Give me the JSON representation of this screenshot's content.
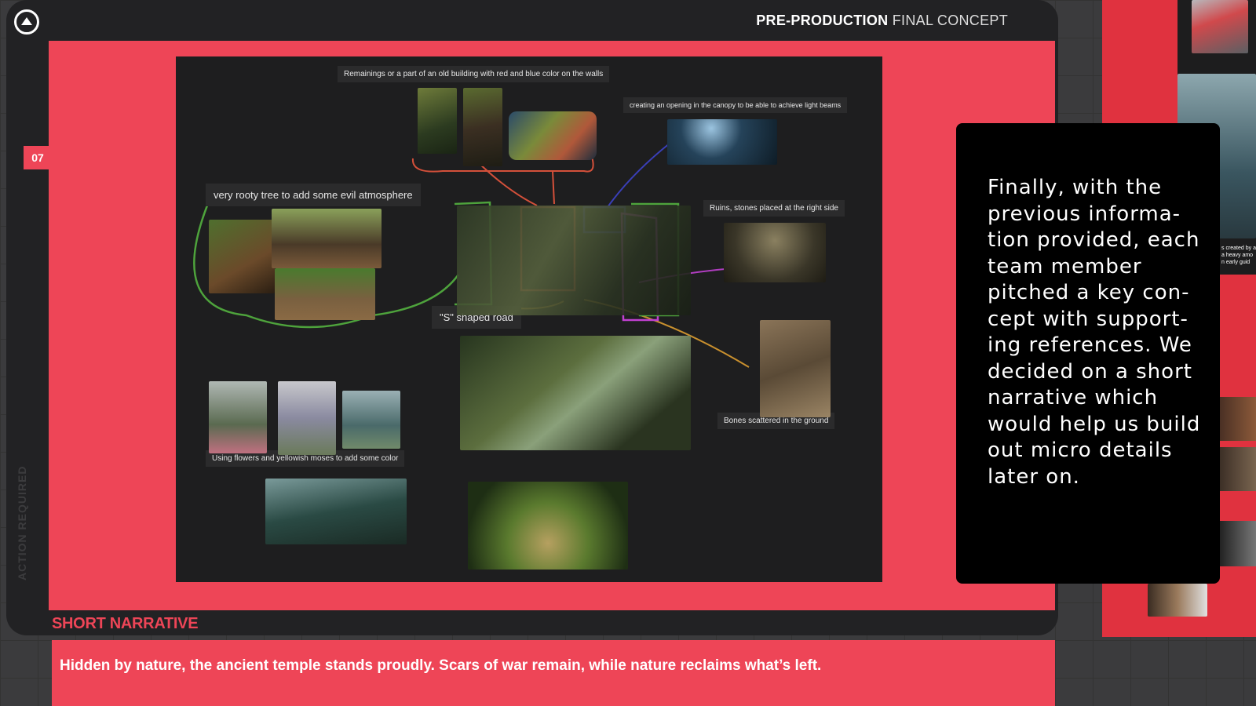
{
  "header": {
    "section_bold": "PRE-PRODUCTION",
    "section_light": "FINAL CONCEPT"
  },
  "page_number": "07",
  "vertical_label": "ACTION REQUIRED",
  "moodboard": {
    "captions": {
      "building": "Remainings or a part of an old building with red and blue color on the walls",
      "canopy": "creating an opening in the canopy to be able to achieve light beams",
      "tree": "very rooty tree to add some evil atmosphere",
      "ruins": "Ruins, stones placed at the right side",
      "road": "\"S\" shaped road",
      "bones": "Bones scattered in the ground",
      "flowers": "Using flowers and yellowish moses to add some color"
    },
    "image_icons": [
      "ruined-temple-jungle-image",
      "mossy-building-image",
      "floating-island-image",
      "light-beam-forest-image",
      "rooty-tree-image",
      "ruins-stones-image",
      "main-concept-sketch-image",
      "final-concept-render-image",
      "bones-ground-image",
      "flowers-fog-image",
      "abandoned-church-image",
      "jungle-road-image"
    ]
  },
  "callout": {
    "text": "Finally, with the previous informa-tion provided, each team member pitched a key con-cept with support-ing references. We decided on a short narrative which would help us build out micro details later on."
  },
  "narrative": {
    "title": "SHORT NARRATIVE",
    "text": "Hidden by nature, the ancient temple stands proudly. Scars of war remain, while nature reclaims what’s left."
  },
  "side_panel": {
    "snippet": "s created by a\na heavy amo\nn early guid"
  },
  "colors": {
    "accent_red": "#ee4557",
    "board_bg": "#1e1e1f",
    "frame_bg": "#222224"
  }
}
